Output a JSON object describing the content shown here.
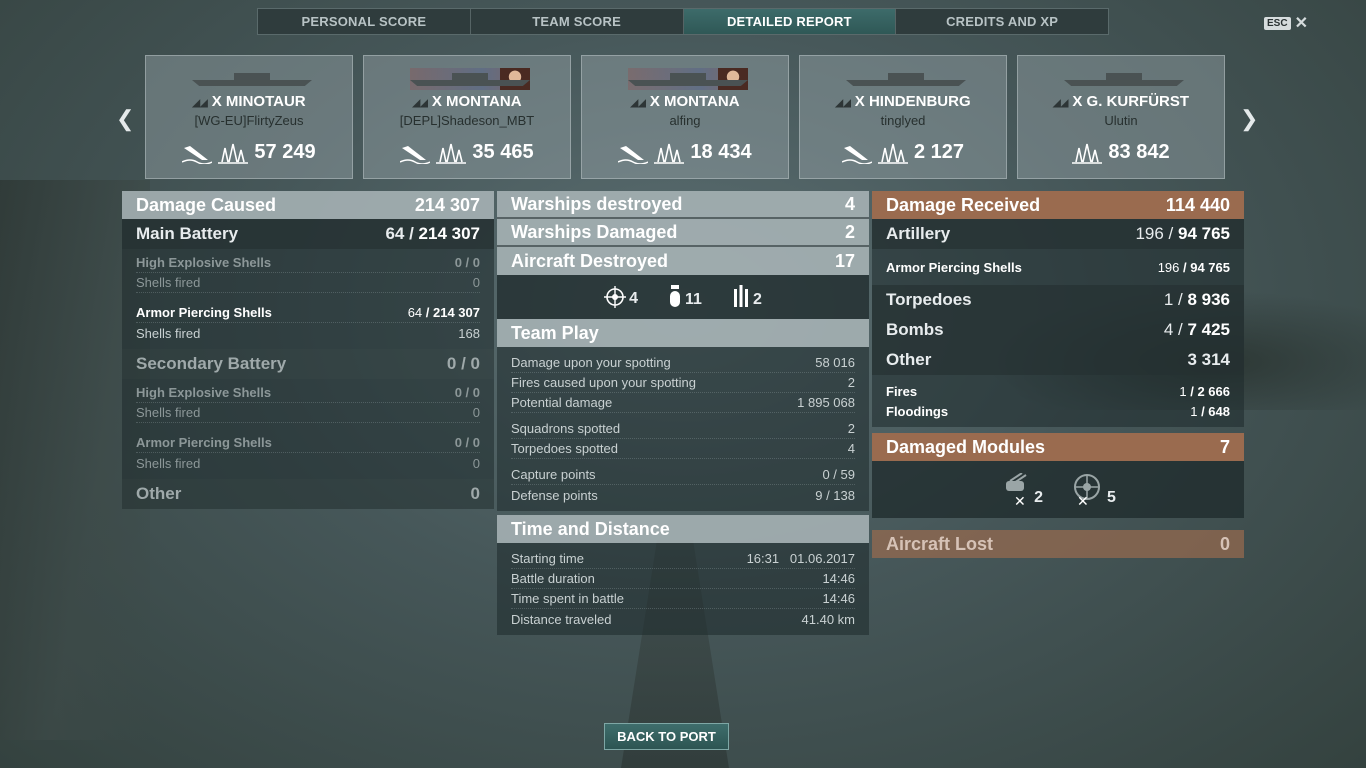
{
  "tabs": [
    "PERSONAL SCORE",
    "TEAM SCORE",
    "DETAILED REPORT",
    "CREDITS AND XP"
  ],
  "active_tab": 2,
  "esc_label": "ESC",
  "cards": [
    {
      "ship": "X MINOTAUR",
      "player": "[WG-EU]FlirtyZeus",
      "damage": "57 249",
      "has_sink": true
    },
    {
      "ship": "X MONTANA",
      "player": "[DEPL]Shadeson_MBT",
      "damage": "35 465",
      "has_sink": true
    },
    {
      "ship": "X MONTANA",
      "player": "alfing",
      "damage": "18 434",
      "has_sink": true
    },
    {
      "ship": "X HINDENBURG",
      "player": "tinglyed",
      "damage": "2 127",
      "has_sink": true
    },
    {
      "ship": "X G. KURFÜRST",
      "player": "Ulutin",
      "damage": "83 842",
      "has_sink": false
    }
  ],
  "left": {
    "header": {
      "label": "Damage Caused",
      "value": "214 307"
    },
    "main_battery": {
      "label": "Main Battery",
      "hits": "64",
      "dmg": "214 307"
    },
    "mb_rows": [
      {
        "label": "High Explosive Shells",
        "value": "0 / 0"
      },
      {
        "label": "Shells fired",
        "value": "0"
      },
      {
        "label": "Armor Piercing Shells",
        "hits": "64",
        "dmg": "214 307"
      },
      {
        "label": "Shells fired",
        "value": "168"
      }
    ],
    "secondary": {
      "label": "Secondary Battery",
      "value": "0 / 0"
    },
    "sec_rows": [
      {
        "label": "High Explosive Shells",
        "value": "0 / 0"
      },
      {
        "label": "Shells fired",
        "value": "0"
      },
      {
        "label": "Armor Piercing Shells",
        "value": "0 / 0"
      },
      {
        "label": "Shells fired",
        "value": "0"
      }
    ],
    "other": {
      "label": "Other",
      "value": "0"
    }
  },
  "middle": {
    "warships_destroyed": {
      "label": "Warships destroyed",
      "value": "4"
    },
    "warships_damaged": {
      "label": "Warships Damaged",
      "value": "2"
    },
    "aircraft_destroyed": {
      "label": "Aircraft Destroyed",
      "value": "17"
    },
    "aircraft_icons": [
      "4",
      "11",
      "2"
    ],
    "team_play": {
      "label": "Team Play"
    },
    "tp_rows": [
      {
        "label": "Damage upon your spotting",
        "value": "58 016"
      },
      {
        "label": "Fires caused upon your spotting",
        "value": "2"
      },
      {
        "label": "Potential damage",
        "value": "1 895 068"
      },
      {
        "label": "Squadrons spotted",
        "value": "2"
      },
      {
        "label": "Torpedoes spotted",
        "value": "4"
      },
      {
        "label": "Capture points",
        "value": "0 / 59"
      },
      {
        "label": "Defense points",
        "value": "9 / 138"
      }
    ],
    "time": {
      "label": "Time and Distance"
    },
    "time_rows": [
      {
        "label": "Starting time",
        "value": "16:31   01.06.2017"
      },
      {
        "label": "Battle duration",
        "value": "14:46"
      },
      {
        "label": "Time spent in battle",
        "value": "14:46"
      },
      {
        "label": "Distance traveled",
        "value": "41.40 km"
      }
    ]
  },
  "right": {
    "header": {
      "label": "Damage Received",
      "value": "114 440"
    },
    "artillery": {
      "label": "Artillery",
      "hits": "196",
      "dmg": "94 765"
    },
    "ap": {
      "label": "Armor Piercing Shells",
      "hits": "196",
      "dmg": "94 765"
    },
    "torpedoes": {
      "label": "Torpedoes",
      "hits": "1",
      "dmg": "8 936"
    },
    "bombs": {
      "label": "Bombs",
      "hits": "4",
      "dmg": "7 425"
    },
    "other": {
      "label": "Other",
      "value": "3 314"
    },
    "fires": {
      "label": "Fires",
      "hits": "1",
      "dmg": "2 666"
    },
    "floodings": {
      "label": "Floodings",
      "hits": "1",
      "dmg": "648"
    },
    "modules": {
      "label": "Damaged Modules",
      "value": "7"
    },
    "module_icons": [
      "2",
      "5"
    ],
    "aircraft_lost": {
      "label": "Aircraft Lost",
      "value": "0"
    }
  },
  "back_button": "BACK TO PORT"
}
